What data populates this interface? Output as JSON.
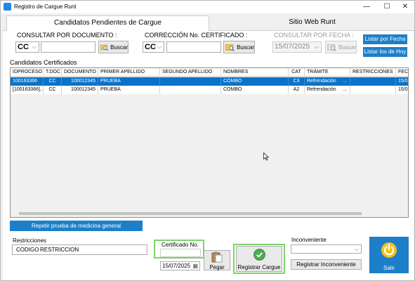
{
  "window": {
    "title": "Registro de Cargue Runt",
    "min": "—",
    "max": "☐",
    "close": "✕"
  },
  "tabs": [
    {
      "label": "Candidatos Pendientes de Cargue"
    },
    {
      "label": "Sitio Web Runt"
    }
  ],
  "search": {
    "by_document_label": "CONSULTAR POR DOCUMENTO :",
    "by_document_type": "CC",
    "by_document_button": "Buscar",
    "by_certificate_label": "CORRECCIÓN No. CERTIFICADO :",
    "by_certificate_type": "CC",
    "by_certificate_button": "Buscar",
    "by_date_label": "CONSULTAR POR FECHA :",
    "by_date_value": "15/07/2025",
    "by_date_button": "Buscar",
    "list_by_date": "Listar por Fecha",
    "list_today": "Listar los de Hoy"
  },
  "grid": {
    "title": "Candidatos Certificados",
    "columns": [
      "IDPROCESO",
      "T.DOC",
      "DOCUMENTO",
      "PRIMER APELLIDO",
      "SEGUNDO APELLIDO",
      "NOMBRES",
      "CAT",
      "TRÁMITE",
      "RESTRICCIONES",
      "FEC"
    ],
    "rows": [
      {
        "idproceso": "100163366",
        "tdoc": "CC",
        "documento": "100012345",
        "primer_apellido": "PRUEBA",
        "segundo_apellido": "",
        "nombres": "COMBO",
        "cat": "C3",
        "tramite": "Refrendación",
        "tramite_more": "...",
        "restricciones": "",
        "fecha": "15/0"
      },
      {
        "idproceso": "[100163366]...",
        "tdoc": "CC",
        "documento": "100012345",
        "primer_apellido": "PRUEBA",
        "segundo_apellido": "",
        "nombres": "COMBO",
        "cat": "A2",
        "tramite": "Refrendación",
        "tramite_more": "...",
        "restricciones": "",
        "fecha": "15/0"
      }
    ]
  },
  "repeat_button": "Repetir prueba de medicina general",
  "restrictions": {
    "label": "Restricciones",
    "code_header": "CODIGO",
    "restriction_header": "RESTRICCION"
  },
  "certificate": {
    "label": "Certificado No.",
    "value": "",
    "date": "15/07/2025",
    "paste": "Pegar"
  },
  "register_button": "Registrar Cargue",
  "inconvenience": {
    "label": "Inconveniente",
    "value": "",
    "button": "Registrar Inconveniente"
  },
  "exit_button": "Salir",
  "colors": {
    "accent": "#1d7fc9",
    "selection": "#0b72c7",
    "highlight": "#7cd36a"
  }
}
